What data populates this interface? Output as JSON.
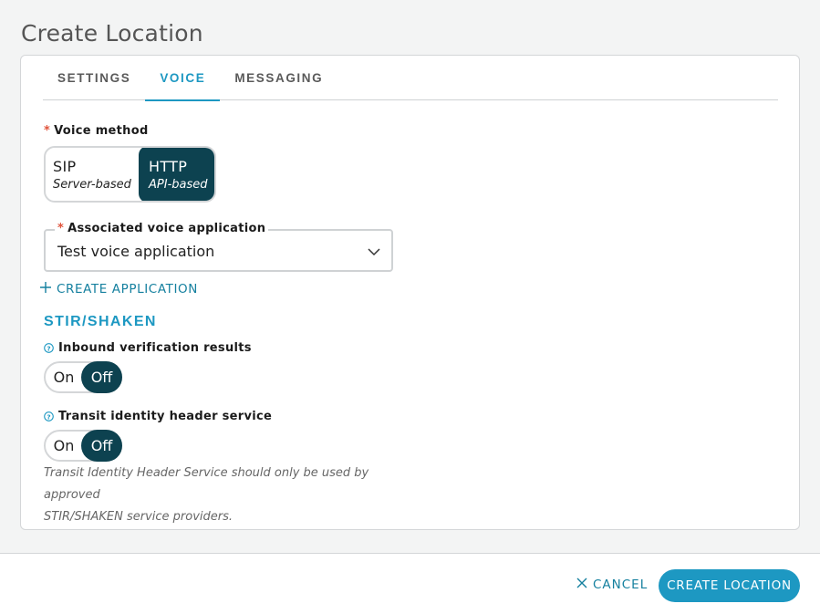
{
  "page": {
    "title": "Create Location"
  },
  "tabs": [
    {
      "label": "SETTINGS",
      "active": false
    },
    {
      "label": "VOICE",
      "active": true
    },
    {
      "label": "MESSAGING",
      "active": false
    }
  ],
  "voice_method": {
    "label": "Voice method",
    "required_mark": "*",
    "options": [
      {
        "main": "SIP",
        "sub": "Server-based",
        "selected": false
      },
      {
        "main": "HTTP",
        "sub": "API-based",
        "selected": true
      }
    ]
  },
  "voice_app": {
    "label": "Associated voice application",
    "required_mark": "*",
    "value": "Test voice application"
  },
  "create_application": {
    "label": "CREATE APPLICATION"
  },
  "stir_shaken": {
    "title": "STIR/SHAKEN",
    "inbound": {
      "label": "Inbound verification results",
      "on_label": "On",
      "off_label": "Off",
      "value": "Off"
    },
    "transit": {
      "label": "Transit identity header service",
      "on_label": "On",
      "off_label": "Off",
      "value": "Off"
    },
    "helper_line1": "Transit Identity Header Service should only be used by approved",
    "helper_line2": "STIR/SHAKEN service providers."
  },
  "footer": {
    "cancel_label": "CANCEL",
    "create_label": "CREATE LOCATION"
  },
  "colors": {
    "accent": "#1d98c2",
    "selected_fill": "#0d4250",
    "required": "#e0533b"
  },
  "icons": {
    "plus": "plus-icon",
    "chevron": "chevron-down-icon",
    "help": "help-circle-icon",
    "close": "close-icon"
  }
}
